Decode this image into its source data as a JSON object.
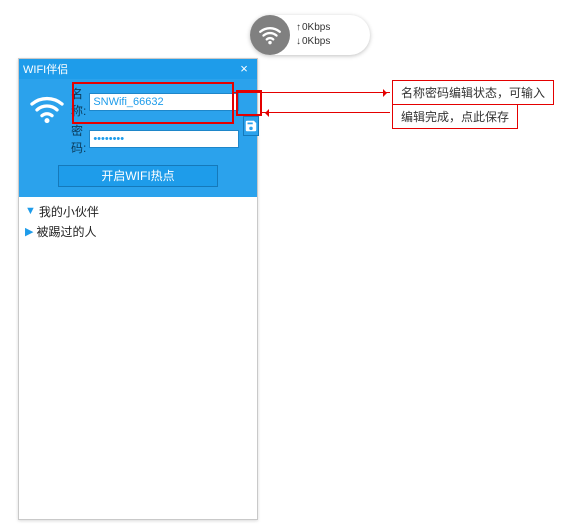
{
  "pill": {
    "up": "0Kbps",
    "down": "0Kbps"
  },
  "window": {
    "title": "WIFI伴侣",
    "name_label": "名称:",
    "password_label": "密码:",
    "name_value": "SNWifi_66632",
    "password_value": "••••••••",
    "start_label": "开启WIFI热点"
  },
  "list": [
    {
      "text": "我的小伙伴",
      "expanded": true
    },
    {
      "text": "被踢过的人",
      "expanded": false
    }
  ],
  "annotations": {
    "a1": "名称密码编辑状态，可输入",
    "a2": "编辑完成，点此保存"
  }
}
